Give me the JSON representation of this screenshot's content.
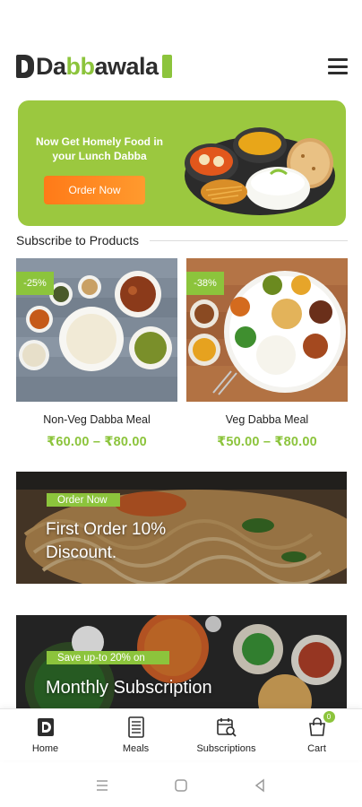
{
  "app": {
    "logo_prefix": "Da",
    "logo_accent": "bb",
    "logo_suffix": "awala",
    "brand_color": "#8cc43c",
    "dark_color": "#2d2d2d"
  },
  "header": {
    "menu_icon": "hamburger-icon"
  },
  "hero": {
    "title": "Now Get Homely Food in your Lunch Dabba",
    "button_label": "Order Now",
    "background": "#9bc83f",
    "button_color": "#ff7a18"
  },
  "section": {
    "title": "Subscribe to Products"
  },
  "products": [
    {
      "badge": "-25%",
      "name": "Non-Veg Dabba Meal",
      "price": "₹60.00 – ₹80.00"
    },
    {
      "badge": "-38%",
      "name": "Veg Dabba Meal",
      "price": "₹50.00 – ₹80.00"
    }
  ],
  "promos": [
    {
      "tag": "Order Now",
      "title": "First Order 10% Discount."
    },
    {
      "tag": "Save up-to 20% on",
      "title": "Monthly Subscription"
    }
  ],
  "bottom_nav": {
    "items": [
      {
        "label": "Home",
        "icon": "home-icon"
      },
      {
        "label": "Meals",
        "icon": "meals-icon"
      },
      {
        "label": "Subscriptions",
        "icon": "subscriptions-icon"
      },
      {
        "label": "Cart",
        "icon": "cart-icon"
      }
    ],
    "cart_count": "0"
  },
  "system_nav": {
    "icons": [
      "recent-apps-icon",
      "home-circle-icon",
      "back-icon"
    ]
  }
}
